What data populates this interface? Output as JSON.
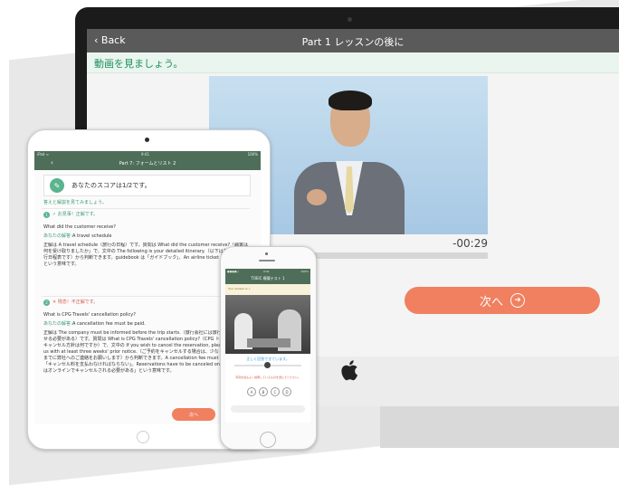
{
  "imac": {
    "nav": {
      "back": "‹ Back",
      "title": "Part 1 レッスンの後に"
    },
    "subheading": "動画を見ましょう。",
    "video": {
      "time_remaining": "-00:29",
      "progress": 0.27
    },
    "next_button": {
      "label": "次へ",
      "icon": "arrow-circle-right-icon"
    },
    "apple_logo": "apple-icon"
  },
  "ipad": {
    "status": {
      "left": "iPad ≈",
      "center": "9:41",
      "right": "100%"
    },
    "nav_title": "Part 7: フォームとリスト 2",
    "score": "あなたのスコアは1/2です。",
    "instruction": "答えと解説を見てみましょう。",
    "q1": {
      "badge": "1",
      "result": "✓ お見事！正解です。",
      "question": "What did the customer receive?",
      "answer_label": "あなたの解答：",
      "answer": "A travel schedule",
      "explanation": "正解は A travel schedule（旅行の日程）です。質問は What did the customer receive?「顧客は何を受け取りましたか」で、文中の The following is your detailed itinerary.（以下はあなたの旅行日程表です）から判断できます。guidebook は「ガイドブック」、An airline ticket は「航空券」という意味です。"
    },
    "q2": {
      "badge": "2",
      "result": "✕ 残念！不正解です。",
      "question": "What is CPG Travels' cancellation policy?",
      "answer_label": "あなたの解答：",
      "answer": "A cancellation fee must be paid.",
      "explanation": "正解は The company must be informed before the trip starts.（旅行会社には旅行開始前に知らせる必要がある）です。質問は What is CPG Travels' cancellation policy?（CPG トラベルズ社のキャンセル方針は何ですか）で、文中の If you wish to cancel the reservation, please contact us with at least three weeks' prior notice.（ご予約をキャンセルする場合は、少なくとも3週間前までに弊社へのご連絡をお願いします）から判断できます。A cancellation fee must be paid. は「キャンセル料を支払わなければならない」。Reservations have to be canceled online. は「予約はオンラインでキャンセルされる必要がある」という意味です。"
    },
    "next_button": "次へ"
  },
  "iphone": {
    "status": {
      "left": "●●●●○",
      "center": "9:41",
      "right": "100%"
    },
    "nav_title": "TOEIC 模擬テスト 1",
    "strip": "Your answer is ✓",
    "sub": "正しく回答できています。",
    "question": "写真を最もよく説明しているものを選んでください。",
    "choices": [
      "A",
      "B",
      "C",
      "D"
    ]
  }
}
